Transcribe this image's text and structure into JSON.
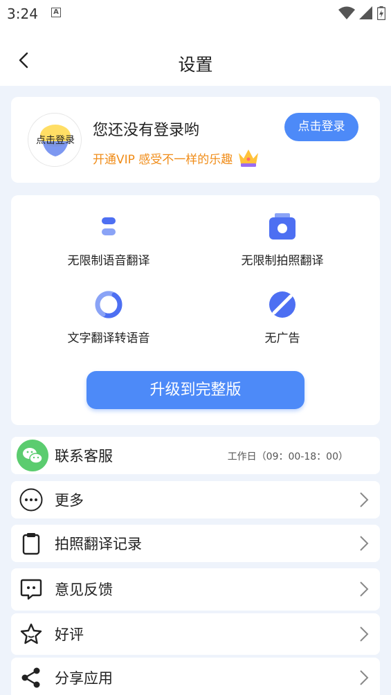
{
  "status_bar": {
    "time": "3:24",
    "notif_letter": "A"
  },
  "header": {
    "title": "设置",
    "back_icon": "chevron-left-icon"
  },
  "profile": {
    "avatar_label": "点击登录",
    "status_text": "您还没有登录哟",
    "vip_text": "开通VIP 感受不一样的乐趣",
    "login_button": "点击登录"
  },
  "features": {
    "items": [
      {
        "label": "无限制语音翻译",
        "icon": "voice-translate-icon"
      },
      {
        "label": "无限制拍照翻译",
        "icon": "camera-translate-icon"
      },
      {
        "label": "文字翻译转语音",
        "icon": "text-to-speech-icon"
      },
      {
        "label": "无广告",
        "icon": "no-ads-icon"
      }
    ],
    "upgrade_button": "升级到完整版"
  },
  "menu": {
    "contact": {
      "label": "联系客服",
      "note": "工作日（09：00-18：00）"
    },
    "more": {
      "label": "更多"
    },
    "history": {
      "label": "拍照翻译记录"
    },
    "feedback": {
      "label": "意见反馈"
    },
    "rate": {
      "label": "好评"
    },
    "share": {
      "label": "分享应用"
    }
  },
  "colors": {
    "accent": "#4d8af8",
    "vip": "#f08c18",
    "background": "#eef3fb",
    "wechat": "#5bcc6f"
  }
}
